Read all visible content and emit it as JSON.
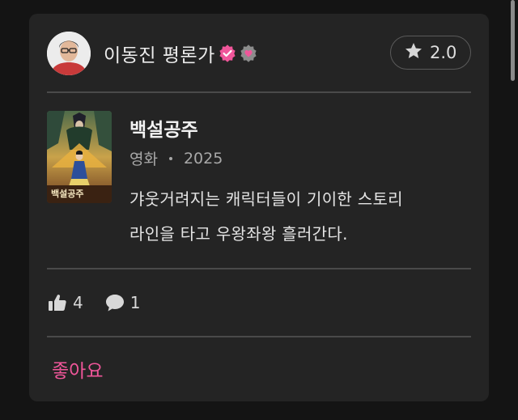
{
  "review": {
    "author_name": "이동진 평론가",
    "rating": "2.0",
    "movie_title": "백설공주",
    "movie_type": "영화",
    "movie_year": "2025",
    "poster_title": "백설공주",
    "text_line1": "갸웃거려지는 캐릭터들이 기이한 스토리",
    "text_line2": "라인을 타고 우왕좌왕 흘러간다.",
    "likes": "4",
    "comments": "1",
    "like_button_label": "좋아요"
  },
  "colors": {
    "background": "#141414",
    "card": "#242424",
    "accent_pink": "#f0569a",
    "divider": "#4a4a4a"
  },
  "icons": {
    "rating": "star-icon",
    "likes": "thumbs-up-icon",
    "comments": "speech-bubble-icon",
    "badge_primary": "verified-badge-icon",
    "badge_secondary": "critic-badge-icon"
  }
}
